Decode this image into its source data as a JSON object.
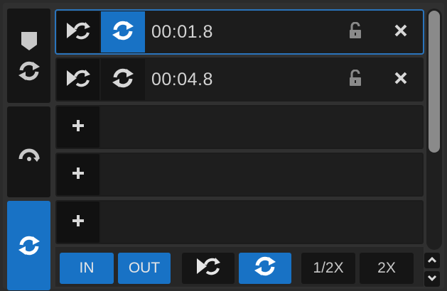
{
  "colors": {
    "accent": "#1872c5",
    "panel": "#151515",
    "row_bg": "#1c1c1c",
    "text": "#c8c8c8"
  },
  "modes": [
    {
      "name": "hotcue",
      "icons": [
        "cue-shield-icon",
        "loop-arrows-icon"
      ],
      "active": false
    },
    {
      "name": "roll",
      "icons": [
        "roll-arc-icon"
      ],
      "active": false
    },
    {
      "name": "loop",
      "icons": [
        "loop-arrows-icon"
      ],
      "active": true
    }
  ],
  "loops": [
    {
      "time": "00:01.8",
      "loop_active": true,
      "selected": true,
      "icons": [
        "play-loop-icon",
        "loop-arrows-icon",
        "unlock-icon",
        "close-icon"
      ]
    },
    {
      "time": "00:04.8",
      "loop_active": false,
      "selected": false,
      "icons": [
        "play-loop-icon",
        "loop-arrows-icon",
        "unlock-icon",
        "close-icon"
      ]
    }
  ],
  "empty_slots": [
    {
      "icon": "plus-icon"
    },
    {
      "icon": "plus-icon"
    },
    {
      "icon": "plus-icon"
    }
  ],
  "bottom": {
    "in_label": "IN",
    "out_label": "OUT",
    "half_label": "1/2X",
    "double_label": "2X",
    "play_icon": "play-loop-icon",
    "loop_icon": "loop-arrows-icon"
  },
  "scroll": {
    "position_fraction": 0.0,
    "visible_fraction": 0.6
  }
}
